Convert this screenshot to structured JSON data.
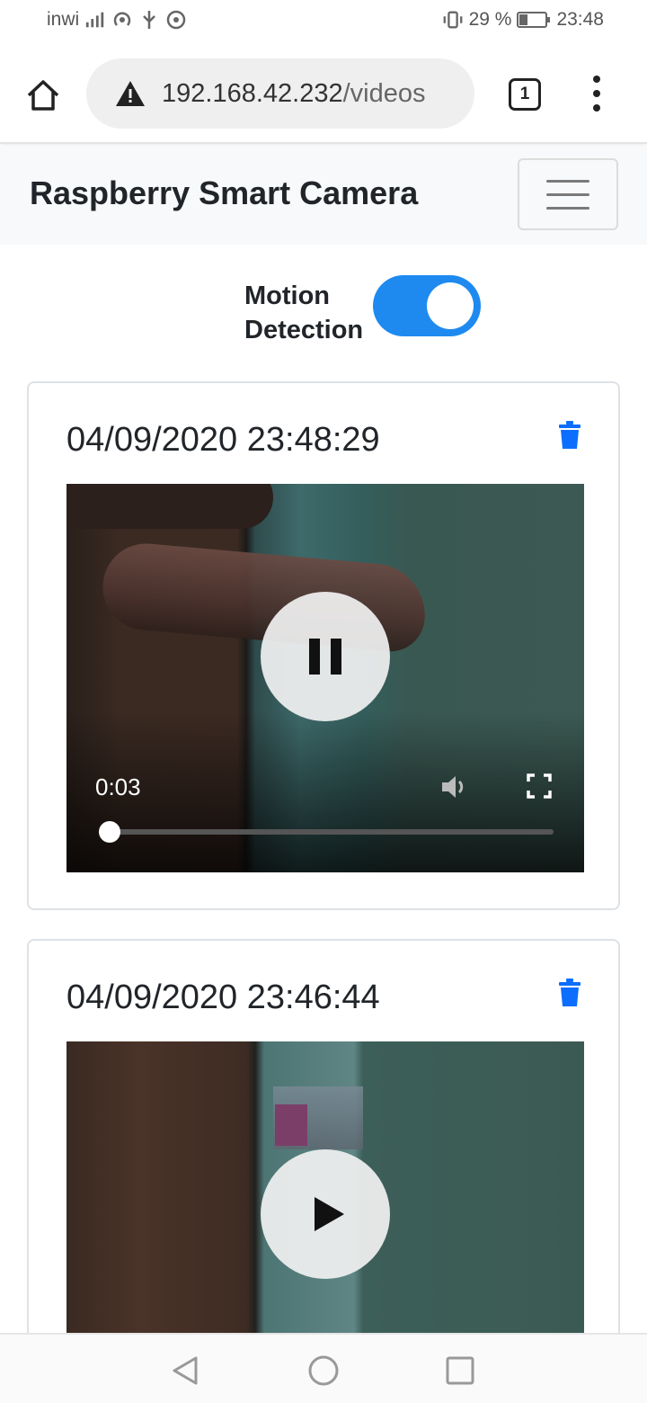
{
  "status_bar": {
    "carrier": "inwi",
    "network": "4G",
    "battery": "29 %",
    "clock": "23:48"
  },
  "browser": {
    "url_host": "192.168.42.232",
    "url_path": "/videos",
    "tab_count": "1"
  },
  "navbar": {
    "brand": "Raspberry Smart Camera"
  },
  "motion_detection": {
    "label": "Motion Detection",
    "enabled": true
  },
  "videos": [
    {
      "title": "04/09/2020 23:48:29",
      "state": "playing",
      "current_time": "0:03",
      "progress": 0
    },
    {
      "title": "04/09/2020 23:46:44",
      "state": "paused"
    }
  ],
  "colors": {
    "accent": "#1e8af0",
    "trash": "#0d6efd",
    "navbar_bg": "#f8f9fa"
  },
  "icons": [
    "home-icon",
    "warning-icon",
    "tabs-icon",
    "more-vert-icon",
    "hamburger-icon",
    "trash-icon",
    "pause-icon",
    "play-icon",
    "volume-icon",
    "fullscreen-icon",
    "back-icon",
    "home-nav-icon",
    "recents-icon"
  ]
}
